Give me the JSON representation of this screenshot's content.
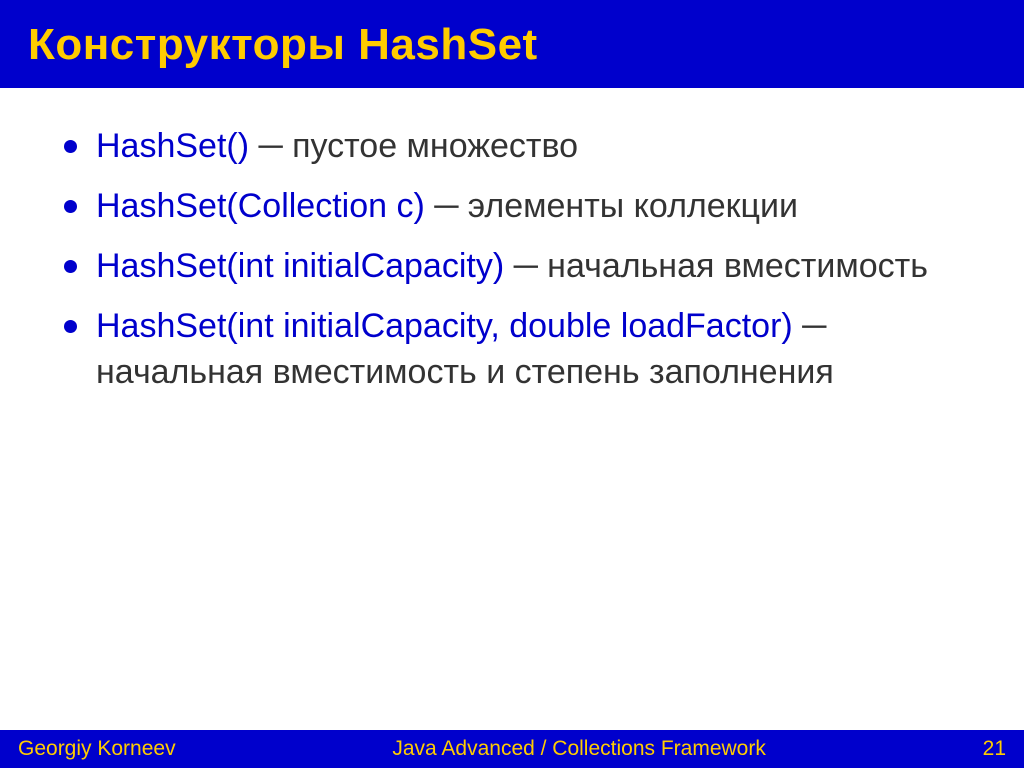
{
  "title": "Конструкторы HashSet",
  "bullets": [
    {
      "sig": "HashSet()",
      "desc": "пустое множество"
    },
    {
      "sig": "HashSet(Collection c)",
      "desc": "элементы коллекции"
    },
    {
      "sig": "HashSet(int initialCapacity)",
      "desc": "начальная вместимость"
    },
    {
      "sig": "HashSet(int initialCapacity, double loadFactor)",
      "desc": "начальная вместимость и степень заполнения"
    }
  ],
  "separator": "─",
  "footer": {
    "author": "Georgiy Korneev",
    "course": "Java Advanced / Collections Framework",
    "page": "21"
  }
}
